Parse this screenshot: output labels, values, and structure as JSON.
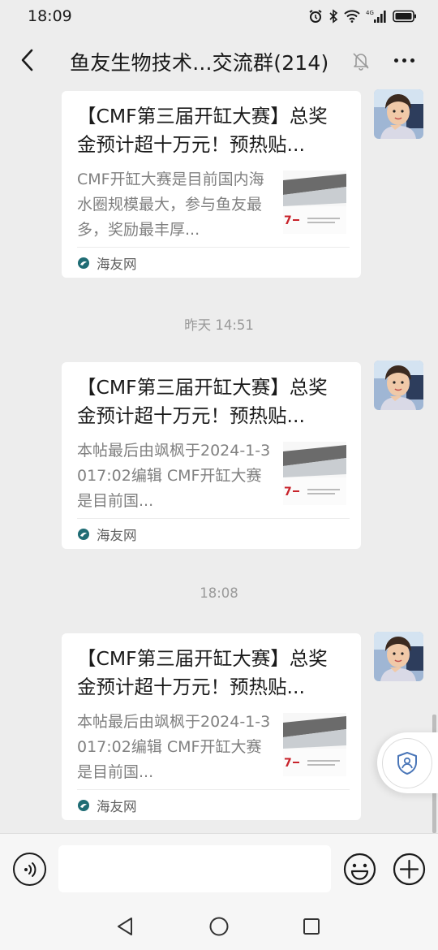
{
  "status_bar": {
    "time": "18:09",
    "network": "4G"
  },
  "chat": {
    "title": "鱼友生物技术...交流群(214)"
  },
  "messages": [
    {
      "title": "【CMF第三届开缸大赛】总奖金预计超十万元！预热贴...",
      "description": "CMF开缸大赛是目前国内海水圈规模最大，参与鱼友最多，奖励最丰厚...",
      "source": "海友网"
    },
    {
      "title": "【CMF第三届开缸大赛】总奖金预计超十万元！预热贴...",
      "description": "本帖最后由飒枫于2024-1-3017:02编辑 CMF开缸大赛是目前国...",
      "source": "海友网"
    },
    {
      "title": "【CMF第三届开缸大赛】总奖金预计超十万元！预热贴...",
      "description": "本帖最后由飒枫于2024-1-3017:02编辑 CMF开缸大赛是目前国...",
      "source": "海友网"
    }
  ],
  "timestamps": [
    "昨天 14:51",
    "18:08"
  ],
  "input": {
    "placeholder": ""
  },
  "icons": {
    "back": "chevron-left-icon",
    "mute": "bell-off-icon",
    "more": "more-dots-icon",
    "voice": "voice-icon",
    "emoji": "emoji-icon",
    "plus": "plus-icon",
    "source": "haiyou-logo-icon",
    "float": "shield-icon"
  },
  "colors": {
    "background": "#ededed",
    "card": "#ffffff",
    "secondary_text": "#808080",
    "timestamp": "#9a9a9a",
    "thumb_red": "#c8232b"
  }
}
